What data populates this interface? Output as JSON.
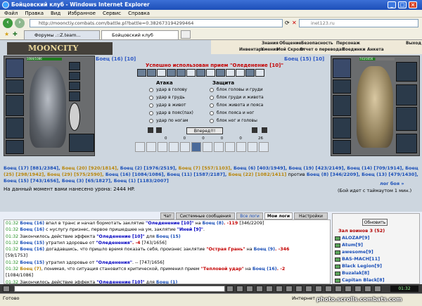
{
  "window": {
    "title": "Бойцовский клуб - Windows Internet Explorer"
  },
  "menu": [
    "Файл",
    "Правка",
    "Вид",
    "Избранное",
    "Сервис",
    "Справка"
  ],
  "address": "http://moonctiy.combats.com/battle.pl?battle=0.382673194299464",
  "search_placeholder": "inet123.ru",
  "tabs": [
    {
      "label": "Форумы .::Z.team..."
    },
    {
      "label": "Бойцовский клуб"
    }
  ],
  "logo": "MOONCITY",
  "top_menu": {
    "row1": [
      "Знания",
      "Общение",
      "Безопасность",
      "Персонаж",
      "Выход"
    ],
    "row2": [
      "Инвентарь",
      "Умения",
      "Мой Скролл",
      "Отчет о переводах",
      "Поединки",
      "Анкета"
    ]
  },
  "left_player": {
    "name": "Боец",
    "level": "16",
    "hp_text": "1084/1086",
    "hp_fraction": 0.998
  },
  "right_player": {
    "name": "Боец",
    "level": "15",
    "hp_text": "743/1656",
    "hp_fraction": 0.449
  },
  "battle_message": "Успешно использован прием \"Оледенение [10]\"",
  "attack": {
    "title": "Атака",
    "options": [
      "удар в голову",
      "удар в грудь",
      "удар в живот",
      "удар в пояс(пах)",
      "удар по ногам"
    ]
  },
  "defense": {
    "title": "Защита",
    "options": [
      "блок головы и груди",
      "блок груди и живота",
      "блок живота и пояса",
      "блок пояса и ног",
      "блок ног и головы"
    ]
  },
  "go_button": "Вперед!!!",
  "counters": [
    "0",
    "0",
    "0",
    "0",
    "0",
    "26"
  ],
  "fighters_line1": [
    {
      "t": "Боец (17) [881/2384],",
      "c": "b"
    },
    {
      "t": "Боец (20) [920/1814],",
      "c": "r"
    },
    {
      "t": "Боец (2) [1976/2519],",
      "c": "b"
    },
    {
      "t": "Боец (7) [557/1103],",
      "c": "r"
    },
    {
      "t": "Боец (6) [403/1949],",
      "c": "b"
    },
    {
      "t": "Боец (19) [423/2149],",
      "c": "b"
    },
    {
      "t": "Боец (14) [709/1914],",
      "c": "b"
    },
    {
      "t": "Боец",
      "c": "b"
    }
  ],
  "fighters_line2": [
    {
      "t": "(25) [298/1942],",
      "c": "r"
    },
    {
      "t": "Боец (29) [575/2590],",
      "c": "r"
    },
    {
      "t": "Боец (16) [1084/1086],",
      "c": "b"
    },
    {
      "t": "Боец (11) [1587/2187],",
      "c": "b"
    },
    {
      "t": "Боец (22) [1082/1411]",
      "c": "r"
    },
    {
      "t": "против",
      "c": "n"
    },
    {
      "t": "Боец (8) [346/2209],",
      "c": "b"
    },
    {
      "t": "Боец (13) [479/1430],",
      "c": "b"
    }
  ],
  "fighters_line3": [
    {
      "t": "Боец (15) [743/1656],",
      "c": "b"
    },
    {
      "t": "Боец (3) [65/1827],",
      "c": "b"
    },
    {
      "t": "Боец (1) [1183/2007]",
      "c": "b"
    }
  ],
  "damage_text": "На данный момент вами нанесено урона: 2444 HP.",
  "log_link": "лог боя »",
  "timeout": "(Бой идет с таймаутом 1 мин.)",
  "chat_tabs": [
    "Чат",
    "Системные сообщения",
    "Все логи",
    "Мои логи",
    "Настройки"
  ],
  "chat_lines": [
    [
      {
        "t": "01:32",
        "c": "t"
      },
      {
        "t": " Боец (16)",
        "c": "b"
      },
      {
        "t": " впал в транс и начал бормотать заклятие ",
        "c": "n"
      },
      {
        "t": "\"Оледенение [10]\"",
        "c": "bl"
      },
      {
        "t": " на ",
        "c": "n"
      },
      {
        "t": "Боец (8)",
        "c": "b"
      },
      {
        "t": ". -119",
        "c": "red"
      },
      {
        "t": " [346/2209]",
        "c": "n"
      }
    ],
    [
      {
        "t": "01:32",
        "c": "t"
      },
      {
        "t": " Боец (16)",
        "c": "b"
      },
      {
        "t": " с нуслугу признес, первое пришедшее на ум, заклятие ",
        "c": "n"
      },
      {
        "t": "\"Иней [9]\"",
        "c": "bl"
      },
      {
        "t": ".",
        "c": "n"
      }
    ],
    [
      {
        "t": "01:32",
        "c": "t"
      },
      {
        "t": " Закончилось действие эффекта ",
        "c": "n"
      },
      {
        "t": "\"Оледенение [10]\"",
        "c": "bl"
      },
      {
        "t": " для ",
        "c": "n"
      },
      {
        "t": "Боец (15)",
        "c": "b"
      }
    ],
    [
      {
        "t": "01:32",
        "c": "t"
      },
      {
        "t": " Боец (15)",
        "c": "b"
      },
      {
        "t": " утратил здоровье от ",
        "c": "n"
      },
      {
        "t": "\"Оледенения\"",
        "c": "bl"
      },
      {
        "t": ". -4",
        "c": "red"
      },
      {
        "t": " [743/1656]",
        "c": "n"
      }
    ],
    [
      {
        "t": "01:32",
        "c": "t"
      },
      {
        "t": " Боец (16)",
        "c": "b"
      },
      {
        "t": " догадавшись, что пришло время показать себя, произнес заклятие ",
        "c": "n"
      },
      {
        "t": "\"Острая Грань\"",
        "c": "red"
      },
      {
        "t": " на ",
        "c": "n"
      },
      {
        "t": "Боец (9)",
        "c": "b"
      },
      {
        "t": ". -346",
        "c": "red"
      }
    ],
    [
      {
        "t": "[59/1753]",
        "c": "n"
      }
    ],
    [
      {
        "t": "01:32",
        "c": "t"
      },
      {
        "t": " Боец (15)",
        "c": "b"
      },
      {
        "t": " утратил здоровье от ",
        "c": "n"
      },
      {
        "t": "\"Оледенения\"",
        "c": "bl"
      },
      {
        "t": ". --",
        "c": "n"
      },
      {
        "t": " [747/1656]",
        "c": "n"
      }
    ],
    [
      {
        "t": "01:32",
        "c": "t"
      },
      {
        "t": " Боец (7)",
        "c": "r"
      },
      {
        "t": ", понимая, что ситуация становится критической, применил прием ",
        "c": "n"
      },
      {
        "t": "\"Тепловой удар\"",
        "c": "red"
      },
      {
        "t": " на ",
        "c": "n"
      },
      {
        "t": "Боец (16)",
        "c": "b"
      },
      {
        "t": ". -2",
        "c": "red"
      }
    ],
    [
      {
        "t": "[1084/1086]",
        "c": "n"
      }
    ],
    [
      {
        "t": "01:32",
        "c": "t"
      },
      {
        "t": " Закончилось действие эффекта ",
        "c": "n"
      },
      {
        "t": "\"Оледенение [10]\"",
        "c": "bl"
      },
      {
        "t": " для ",
        "c": "n"
      },
      {
        "t": "Боец (1)",
        "c": "b"
      }
    ],
    [
      {
        "t": "01:32",
        "c": "t"
      },
      {
        "t": " Боец (1)",
        "c": "b"
      },
      {
        "t": " утратил здоровье от ",
        "c": "n"
      },
      {
        "t": "\"Оледенения\"",
        "c": "bl"
      },
      {
        "t": ". -1",
        "c": "red"
      },
      {
        "t": " [1184/2007]",
        "c": "n"
      }
    ]
  ],
  "refresh_button": "Обновить",
  "room_title": "Зал воинов 3 (52)",
  "players": [
    "ALOZAP[9]",
    "Atum[9]",
    "awesome[9]",
    "BAS-MACH[11]",
    "Black Legion[9]",
    "Buzalak[8]",
    "Capitan Black[8]"
  ],
  "clock": "01:32",
  "status": "Готово",
  "status_zone": "Интернет",
  "watermark": "photo.scrolls.combats.com"
}
